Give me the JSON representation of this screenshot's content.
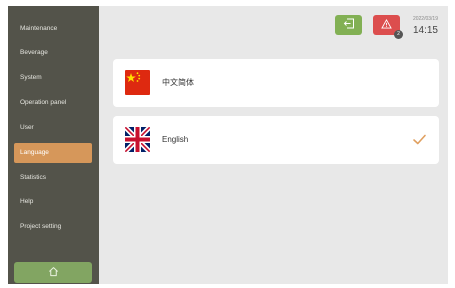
{
  "sidebar": {
    "items": [
      {
        "label": "Maintenance",
        "active": false
      },
      {
        "label": "Beverage",
        "active": false
      },
      {
        "label": "System",
        "active": false
      },
      {
        "label": "Operation panel",
        "active": false
      },
      {
        "label": "User",
        "active": false
      },
      {
        "label": "Language",
        "active": true
      },
      {
        "label": "Statistics",
        "active": false
      },
      {
        "label": "Help",
        "active": false
      },
      {
        "label": "Project setting",
        "active": false
      }
    ],
    "home_icon": "home-icon"
  },
  "header": {
    "exit_icon": "exit-icon",
    "alarm_icon": "warning-icon",
    "alarm_count": "2",
    "date": "2022/03/19",
    "time": "14:15"
  },
  "languages": [
    {
      "label": "中文简体",
      "flag": "china-flag",
      "selected": false
    },
    {
      "label": "English",
      "flag": "uk-flag",
      "selected": true
    }
  ],
  "colors": {
    "sidebar_bg": "#53534a",
    "active_item": "#d6975a",
    "home_button": "#82a562",
    "exit_button": "#82b054",
    "alarm_button": "#dc4e4e",
    "check_mark": "#e0a060",
    "content_bg": "#e8e8e8"
  }
}
